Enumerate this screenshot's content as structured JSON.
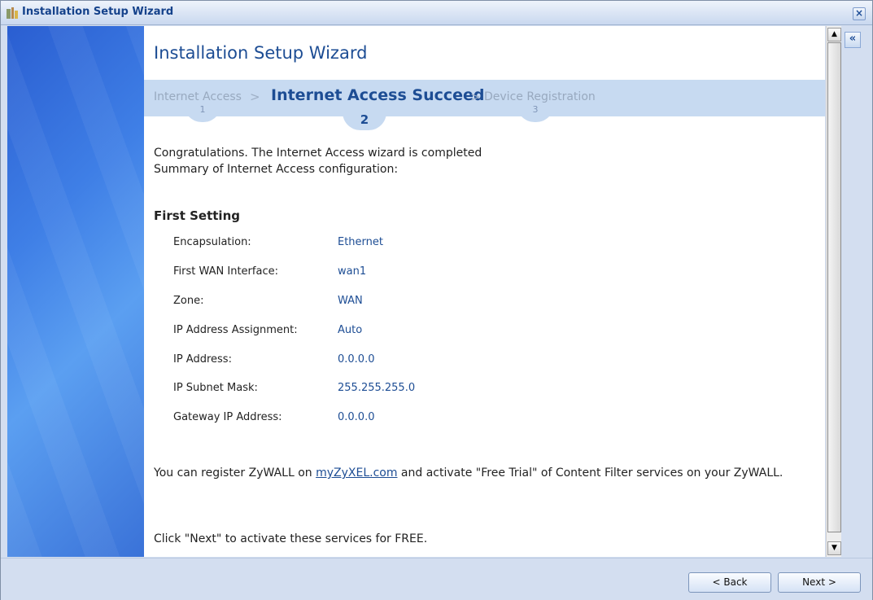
{
  "window": {
    "title": "Installation Setup Wizard",
    "close_glyph": "×"
  },
  "wizard": {
    "title": "Installation Setup Wizard",
    "steps": [
      {
        "label": "Internet Access",
        "number": "1",
        "active": false
      },
      {
        "label": "Internet Access Succeed",
        "number": "2",
        "active": true
      },
      {
        "label": "Device Registration",
        "number": "3",
        "active": false
      }
    ],
    "separator": ">"
  },
  "content": {
    "intro_line1": "Congratulations. The Internet Access wizard is completed",
    "intro_line2": "Summary of Internet Access configuration:",
    "section_title": "First Setting",
    "rows": [
      {
        "label": "Encapsulation:",
        "value": "Ethernet"
      },
      {
        "label": "First WAN Interface:",
        "value": "wan1"
      },
      {
        "label": "Zone:",
        "value": "WAN"
      },
      {
        "label": "IP Address Assignment:",
        "value": "Auto"
      },
      {
        "label": "IP Address:",
        "value": "0.0.0.0"
      },
      {
        "label": "IP Subnet Mask:",
        "value": "255.255.255.0"
      },
      {
        "label": "Gateway IP Address:",
        "value": "0.0.0.0"
      }
    ],
    "register_pre": "You can register ZyWALL on ",
    "register_link": "myZyXEL.com",
    "register_post": " and activate \"Free Trial\" of Content Filter services on your ZyWALL.",
    "next_hint": "Click \"Next\" to activate these services for FREE."
  },
  "footer": {
    "back_label": "< Back",
    "next_label": "Next >"
  },
  "collapse_glyph": "«",
  "colors": {
    "accent": "#1d4d94",
    "step_band": "#c7daf1",
    "sidebar": "#3f7fe6"
  }
}
